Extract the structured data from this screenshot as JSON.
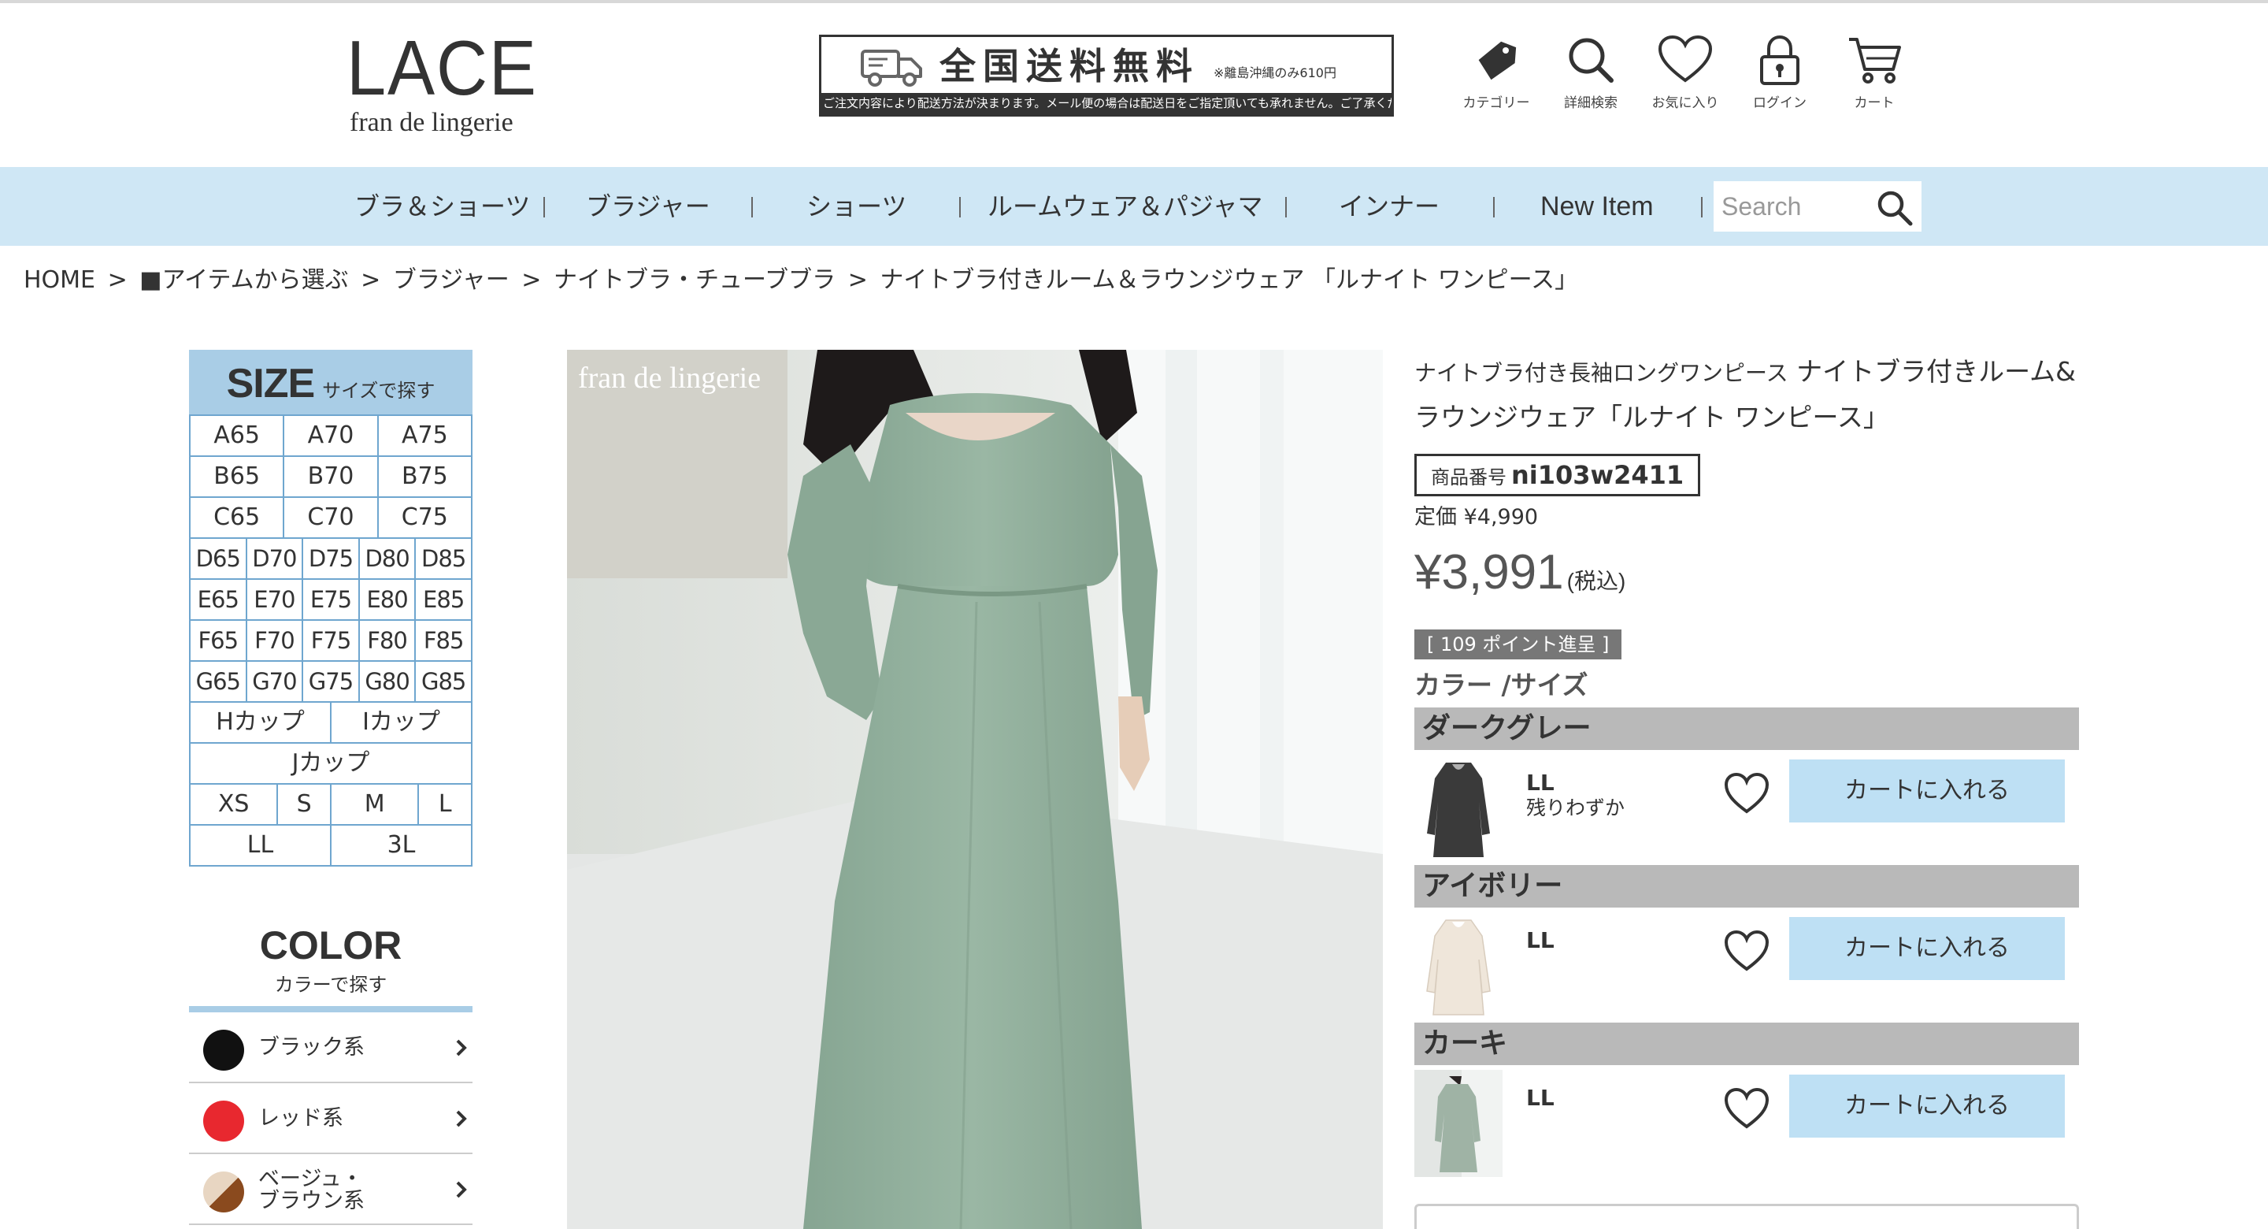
{
  "brand": {
    "logo_main": "LACE",
    "logo_sub": "fran de lingerie"
  },
  "banner": {
    "title": "全国送料無料",
    "note": "※離島沖縄のみ610円",
    "subtext": "ご注文内容により配送方法が決まります。メール便の場合は配送日をご指定頂いても承れません。ご了承ください。"
  },
  "header_icons": [
    {
      "icon": "tag-icon",
      "label": "カテゴリー"
    },
    {
      "icon": "search-icon",
      "label": "詳細検索"
    },
    {
      "icon": "heart-icon",
      "label": "お気に入り"
    },
    {
      "icon": "lock-icon",
      "label": "ログイン"
    },
    {
      "icon": "cart-icon",
      "label": "カート"
    }
  ],
  "nav": {
    "items": [
      "ブラ＆ショーツ",
      "ブラジャー",
      "ショーツ",
      "ルームウェア＆パジャマ",
      "インナー",
      "New Item"
    ],
    "search_placeholder": "Search"
  },
  "breadcrumb": [
    "HOME",
    ">",
    "■アイテムから選ぶ",
    ">",
    "ブラジャー",
    ">",
    "ナイトブラ・チューブブラ",
    ">",
    "ナイトブラ付きルーム＆ラウンジウェア 「ルナイト ワンピース」"
  ],
  "size_panel": {
    "title": "SIZE",
    "subtitle": "サイズで探す",
    "rows": [
      [
        "A65",
        "A70",
        "A75"
      ],
      [
        "B65",
        "B70",
        "B75"
      ],
      [
        "C65",
        "C70",
        "C75"
      ],
      [
        "D65",
        "D70",
        "D75",
        "D80",
        "D85"
      ],
      [
        "E65",
        "E70",
        "E75",
        "E80",
        "E85"
      ],
      [
        "F65",
        "F70",
        "F75",
        "F80",
        "F85"
      ],
      [
        "G65",
        "G70",
        "G75",
        "G80",
        "G85"
      ],
      [
        "Hカップ",
        "Iカップ"
      ],
      [
        "Jカップ"
      ],
      [
        "XS",
        "S",
        "M",
        "L"
      ],
      [
        "LL",
        "3L"
      ]
    ]
  },
  "color_panel": {
    "title": "COLOR",
    "subtitle": "カラーで探す",
    "items": [
      {
        "label": "ブラック系",
        "color": "#111111"
      },
      {
        "label": "レッド系",
        "color": "#e8282f"
      },
      {
        "label": "ベージュ・\nブラウン系",
        "color": "#9a5a2a"
      }
    ]
  },
  "photo": {
    "brand_watermark": "fran de lingerie"
  },
  "product": {
    "name_prefix": "ナイトブラ付き長袖ロングワンピース",
    "name": "ナイトブラ付きルーム&ラウンジウェア「ルナイト ワンピース」",
    "code_label": "商品番号",
    "code": "ni103w2411",
    "list_price": "定価 ¥4,990",
    "price": "¥3,991",
    "tax_label": "(税込)",
    "points": "[ 109 ポイント進呈 ]",
    "color_size_label": "カラー /サイズ"
  },
  "variants": [
    {
      "color_name": "ダークグレー",
      "size": "LL",
      "stock": "残りわずか",
      "cart_label": "カートに入れる",
      "thumb_color": "#3a3a3a"
    },
    {
      "color_name": "アイボリー",
      "size": "LL",
      "stock": "",
      "cart_label": "カートに入れる",
      "thumb_color": "#efe6da"
    },
    {
      "color_name": "カーキ",
      "size": "LL",
      "stock": "",
      "cart_label": "カートに入れる",
      "thumb_color": "#9fb3a5"
    }
  ]
}
